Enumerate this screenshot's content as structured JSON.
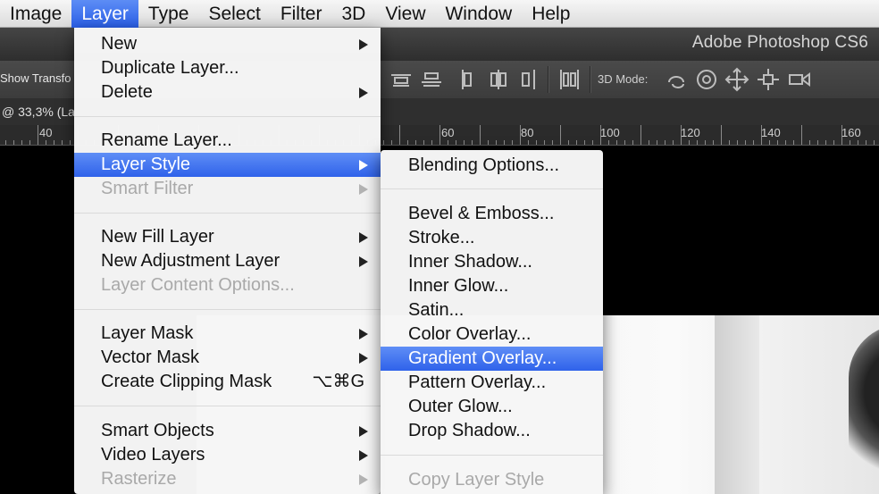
{
  "menubar": {
    "items": [
      "Image",
      "Layer",
      "Type",
      "Select",
      "Filter",
      "3D",
      "View",
      "Window",
      "Help"
    ],
    "active": "Layer"
  },
  "app_title": "Adobe Photoshop CS6",
  "options_bar": {
    "show_transform": "Show Transfo",
    "mode_label": "3D Mode:"
  },
  "document": {
    "tab_label": "@ 33,3% (La",
    "ruler_ticks": [
      "40",
      "60",
      "80",
      "100",
      "120",
      "140",
      "160"
    ]
  },
  "layer_menu": {
    "items": [
      {
        "label": "New",
        "submenu": true,
        "disabled": false
      },
      {
        "label": "Duplicate Layer...",
        "submenu": false,
        "disabled": false
      },
      {
        "label": "Delete",
        "submenu": true,
        "disabled": false
      },
      {
        "label": "Rename Layer...",
        "submenu": false,
        "disabled": false
      },
      {
        "label": "Layer Style",
        "submenu": true,
        "disabled": false,
        "highlighted": true
      },
      {
        "label": "Smart Filter",
        "submenu": true,
        "disabled": true
      },
      {
        "label": "New Fill Layer",
        "submenu": true,
        "disabled": false
      },
      {
        "label": "New Adjustment Layer",
        "submenu": true,
        "disabled": false
      },
      {
        "label": "Layer Content Options...",
        "submenu": false,
        "disabled": true
      },
      {
        "label": "Layer Mask",
        "submenu": true,
        "disabled": false
      },
      {
        "label": "Vector Mask",
        "submenu": true,
        "disabled": false
      },
      {
        "label": "Create Clipping Mask",
        "submenu": false,
        "disabled": false,
        "shortcut": "⌥⌘G"
      },
      {
        "label": "Smart Objects",
        "submenu": true,
        "disabled": false
      },
      {
        "label": "Video Layers",
        "submenu": true,
        "disabled": false
      },
      {
        "label": "Rasterize",
        "submenu": true,
        "disabled": true
      }
    ]
  },
  "layer_style_menu": {
    "items": [
      {
        "label": "Blending Options...",
        "disabled": false
      },
      {
        "label": "Bevel & Emboss...",
        "disabled": false
      },
      {
        "label": "Stroke...",
        "disabled": false
      },
      {
        "label": "Inner Shadow...",
        "disabled": false
      },
      {
        "label": "Inner Glow...",
        "disabled": false
      },
      {
        "label": "Satin...",
        "disabled": false
      },
      {
        "label": "Color Overlay...",
        "disabled": false
      },
      {
        "label": "Gradient Overlay...",
        "disabled": false,
        "highlighted": true
      },
      {
        "label": "Pattern Overlay...",
        "disabled": false
      },
      {
        "label": "Outer Glow...",
        "disabled": false
      },
      {
        "label": "Drop Shadow...",
        "disabled": false
      },
      {
        "label": "Copy Layer Style",
        "disabled": true
      }
    ]
  },
  "colors": {
    "highlight": "#2f62ea",
    "menu_bg": "#f6f6f6",
    "disabled_text": "#a9a9a9",
    "app_chrome": "#3c3c3c"
  },
  "icons": [
    "align-top-icon",
    "align-vcenter-icon",
    "align-bottom-icon",
    "distribute-left-icon",
    "distribute-hcenter-icon",
    "distribute-right-icon",
    "auto-align-icon",
    "3d-rotate-icon",
    "3d-roll-icon",
    "3d-pan-icon",
    "3d-slide-icon",
    "3d-scale-icon"
  ]
}
